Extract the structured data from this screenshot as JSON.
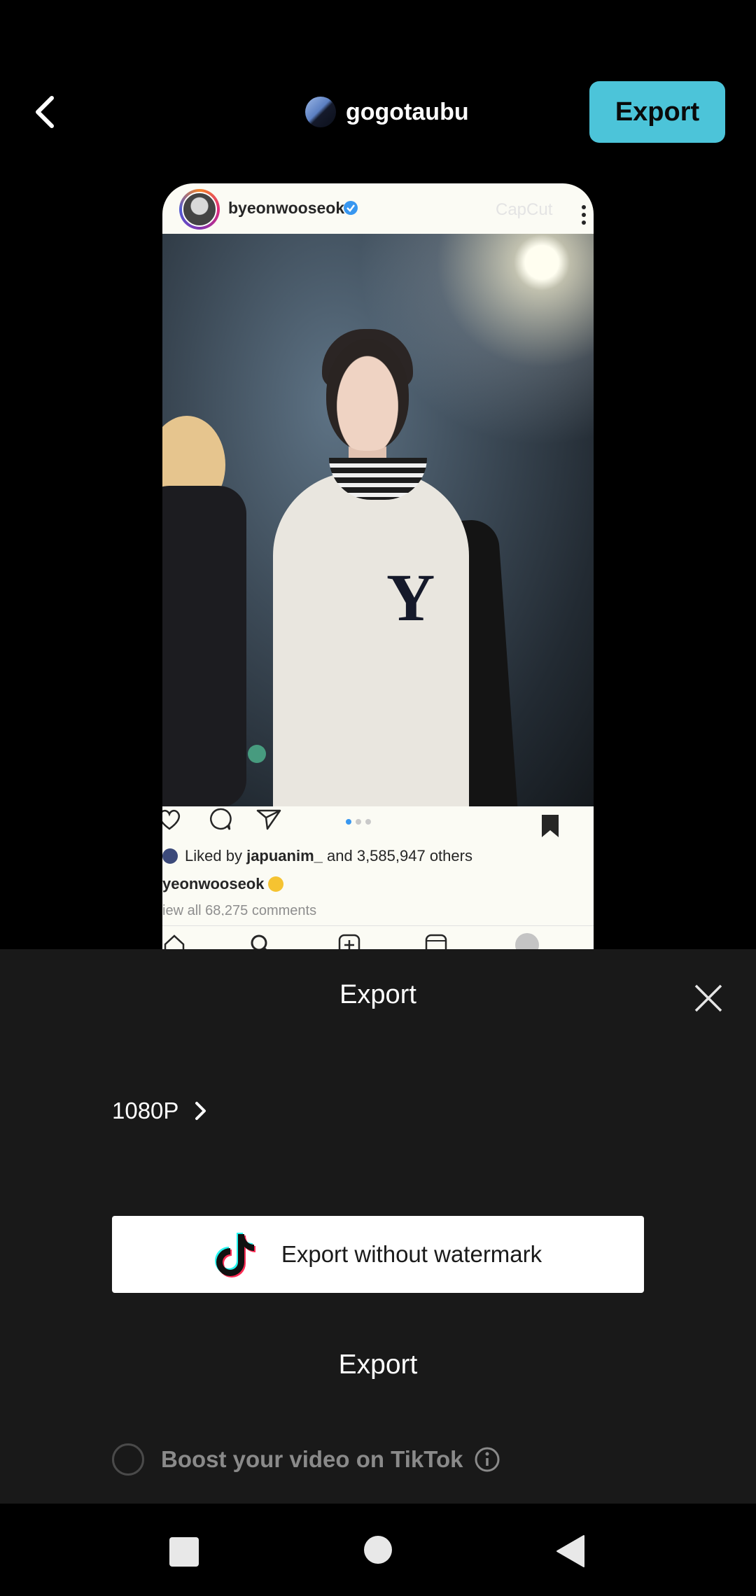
{
  "header": {
    "username": "gogotaubu",
    "export_label": "Export"
  },
  "preview": {
    "ig_username": "byeonwooseok",
    "watermark": "CapCut",
    "liked_prefix": "Liked by",
    "liked_user": "japuanim_",
    "liked_suffix": "and 3,585,947 others",
    "caption_user": "yeonwooseok",
    "comments": "iew all 68,275 comments"
  },
  "sheet": {
    "title": "Export",
    "resolution": "1080P",
    "without_watermark_label": "Export without watermark",
    "export_label": "Export",
    "boost_label": "Boost your video on TikTok"
  },
  "colors": {
    "accent": "#4cc4d9",
    "sheet_bg": "#191919"
  }
}
